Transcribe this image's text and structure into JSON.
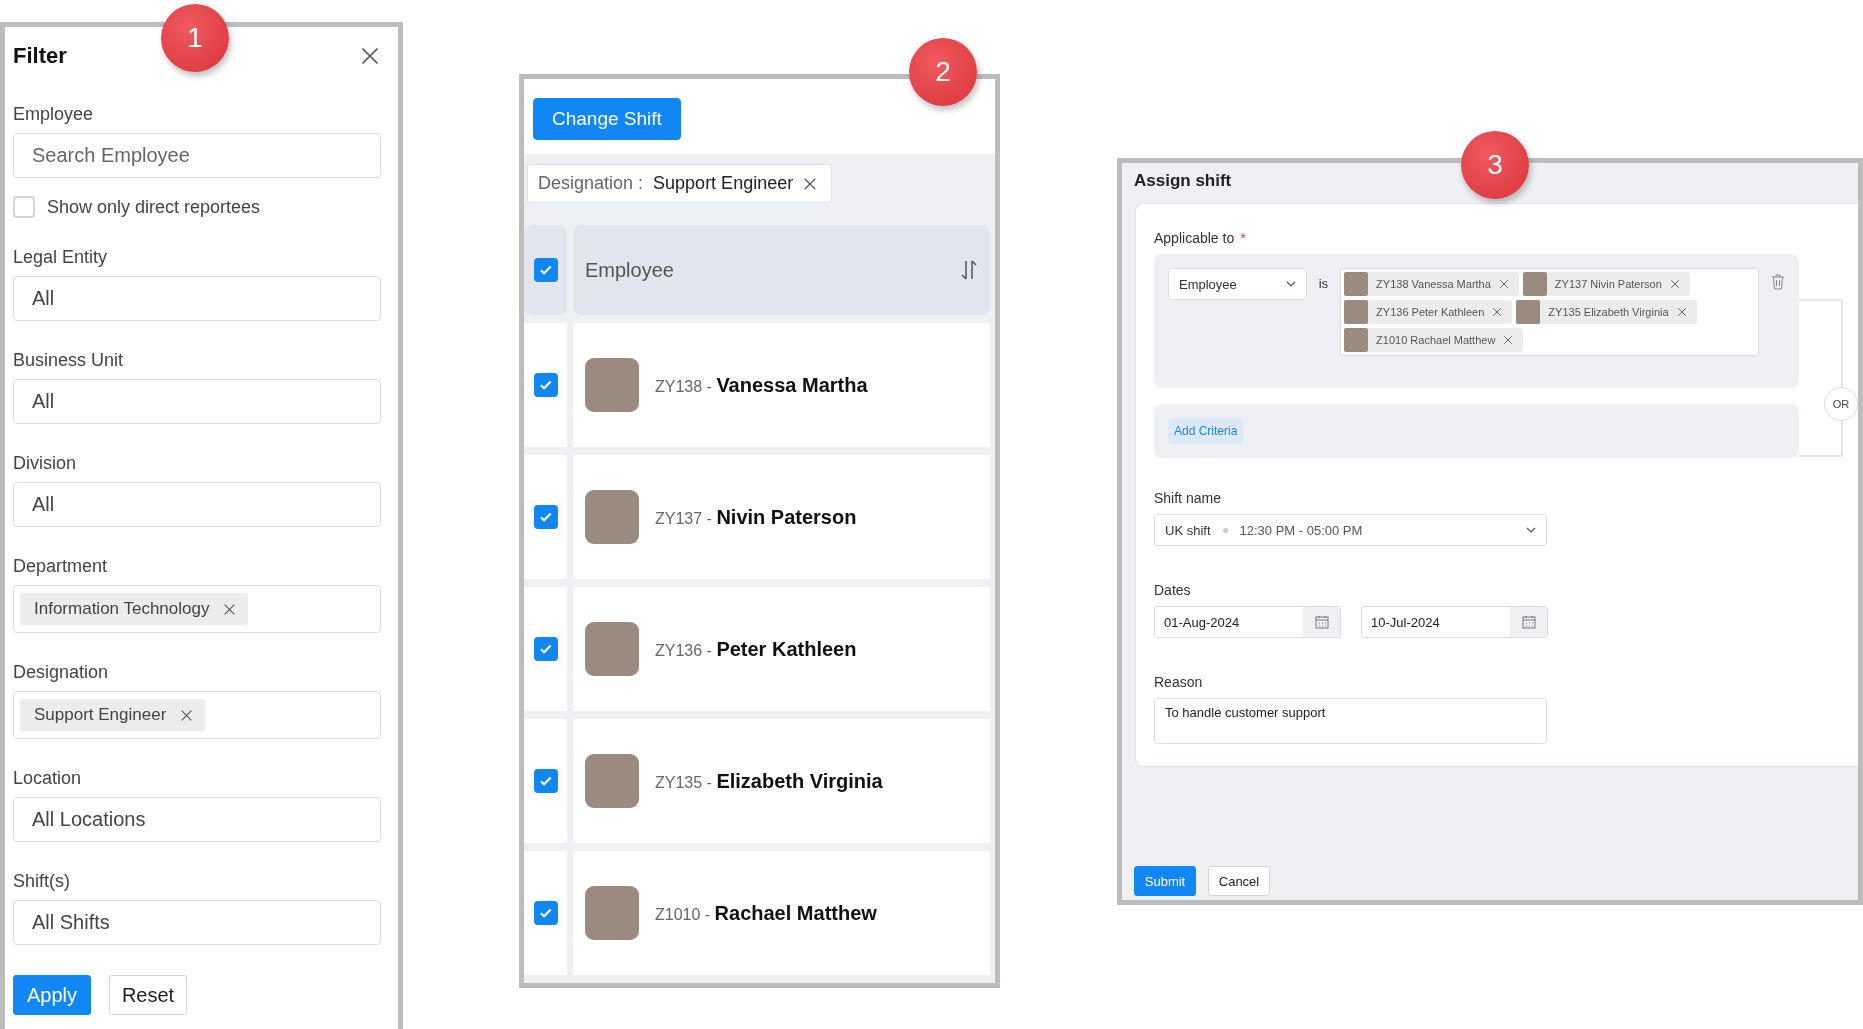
{
  "callouts": [
    "1",
    "2",
    "3"
  ],
  "filter": {
    "title": "Filter",
    "fields": [
      {
        "kind": "search",
        "label": "Employee",
        "placeholder": "Search Employee"
      },
      {
        "kind": "checkbox",
        "label": "Show only direct reportees",
        "checked": false
      },
      {
        "kind": "select",
        "label": "Legal Entity",
        "value": "All"
      },
      {
        "kind": "select",
        "label": "Business Unit",
        "value": "All"
      },
      {
        "kind": "select",
        "label": "Division",
        "value": "All"
      },
      {
        "kind": "tags",
        "label": "Department",
        "tags": [
          "Information Technology"
        ]
      },
      {
        "kind": "tags",
        "label": "Designation",
        "tags": [
          "Support Engineer"
        ]
      },
      {
        "kind": "select",
        "label": "Location",
        "value": "All Locations"
      },
      {
        "kind": "select",
        "label": "Shift(s)",
        "value": "All Shifts"
      }
    ],
    "buttons": [
      {
        "label": "Apply",
        "kind": "primary"
      },
      {
        "label": "Reset",
        "kind": "secondary"
      }
    ]
  },
  "employee_list": {
    "action": "Change Shift",
    "filter_chip": {
      "key": "Designation :",
      "value": "Support Engineer"
    },
    "header": {
      "label": "Employee",
      "checked": true
    },
    "rows": [
      {
        "id": "ZY138 -",
        "name": "Vanessa Martha",
        "checked": true
      },
      {
        "id": "ZY137 -",
        "name": "Nivin Paterson",
        "checked": true
      },
      {
        "id": "ZY136 -",
        "name": "Peter Kathleen",
        "checked": true
      },
      {
        "id": "ZY135 -",
        "name": "Elizabeth Virginia",
        "checked": true
      },
      {
        "id": "Z1010 -",
        "name": "Rachael Matthew",
        "checked": true
      }
    ]
  },
  "assign_shift": {
    "title": "Assign shift",
    "applicable_label": "Applicable to",
    "required_mark": "*",
    "criteria": {
      "field": "Employee",
      "operator": "is",
      "chips": [
        "ZY138 Vanessa Martha",
        "ZY137 Nivin Paterson",
        "ZY136 Peter Kathleen",
        "ZY135 Elizabeth Virginia",
        "Z1010 Rachael Matthew"
      ]
    },
    "or_label": "OR",
    "add_criteria": "Add Criteria",
    "shift_label": "Shift name",
    "shift_name": "UK shift",
    "shift_time": "12:30 PM - 05:00 PM",
    "dates_label": "Dates",
    "dates": [
      "01-Aug-2024",
      "10-Jul-2024"
    ],
    "reason_label": "Reason",
    "reason": "To handle customer support",
    "buttons": [
      {
        "label": "Submit",
        "kind": "primary"
      },
      {
        "label": "Cancel",
        "kind": "secondary"
      }
    ]
  }
}
